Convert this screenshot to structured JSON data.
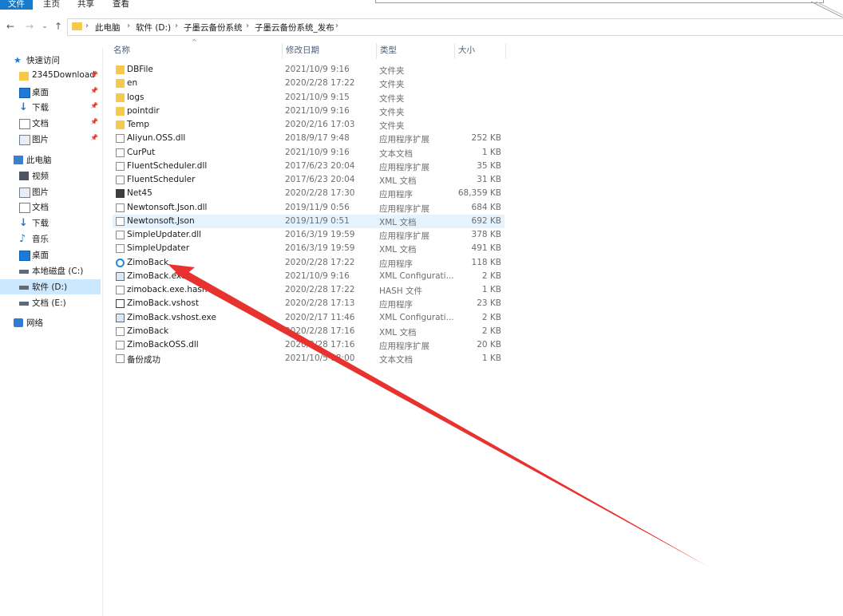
{
  "ribbon": {
    "tabs": [
      {
        "label": "文件",
        "active": true
      },
      {
        "label": "主页",
        "active": false
      },
      {
        "label": "共享",
        "active": false
      },
      {
        "label": "查看",
        "active": false
      }
    ]
  },
  "nav_buttons": {
    "back": "←",
    "forward": "→",
    "recent": "⌄",
    "up": "↑"
  },
  "breadcrumb": [
    "此电脑",
    "软件 (D:)",
    "子墨云备份系统",
    "子墨云备份系统_发布"
  ],
  "breadcrumb_sep": "›",
  "sidebar": {
    "items": [
      {
        "label": "快速访问",
        "icon": "star-icon",
        "indent": 0,
        "pinned": false,
        "selected": false
      },
      {
        "label": "2345Download",
        "icon": "folder-icon",
        "indent": 1,
        "pinned": true,
        "selected": false
      },
      {
        "label": "桌面",
        "icon": "desktop-icon",
        "indent": 1,
        "pinned": true,
        "selected": false
      },
      {
        "label": "下载",
        "icon": "download-icon",
        "indent": 1,
        "pinned": true,
        "selected": false
      },
      {
        "label": "文档",
        "icon": "document-icon",
        "indent": 1,
        "pinned": true,
        "selected": false
      },
      {
        "label": "图片",
        "icon": "pictures-icon",
        "indent": 1,
        "pinned": true,
        "selected": false
      },
      {
        "label": "此电脑",
        "icon": "computer-icon",
        "indent": 0,
        "pinned": false,
        "selected": false
      },
      {
        "label": "视频",
        "icon": "video-icon",
        "indent": 1,
        "pinned": false,
        "selected": false
      },
      {
        "label": "图片",
        "icon": "pictures-icon",
        "indent": 1,
        "pinned": false,
        "selected": false
      },
      {
        "label": "文档",
        "icon": "document-icon",
        "indent": 1,
        "pinned": false,
        "selected": false
      },
      {
        "label": "下载",
        "icon": "download-icon",
        "indent": 1,
        "pinned": false,
        "selected": false
      },
      {
        "label": "音乐",
        "icon": "music-icon",
        "indent": 1,
        "pinned": false,
        "selected": false
      },
      {
        "label": "桌面",
        "icon": "desktop-icon",
        "indent": 1,
        "pinned": false,
        "selected": false
      },
      {
        "label": "本地磁盘 (C:)",
        "icon": "drive-icon",
        "indent": 1,
        "pinned": false,
        "selected": false
      },
      {
        "label": "软件 (D:)",
        "icon": "drive-icon",
        "indent": 1,
        "pinned": false,
        "selected": true
      },
      {
        "label": "文档 (E:)",
        "icon": "drive-icon",
        "indent": 1,
        "pinned": false,
        "selected": false
      },
      {
        "label": "网络",
        "icon": "network-icon",
        "indent": 0,
        "pinned": false,
        "selected": false
      }
    ]
  },
  "pin_glyph": "📌",
  "columns": {
    "name": "名称",
    "date": "修改日期",
    "type": "类型",
    "size": "大小"
  },
  "sort_caret": "^",
  "files": [
    {
      "name": "DBFile",
      "date": "2021/10/9 9:16",
      "type": "文件夹",
      "size": "",
      "icon": "folder-icon",
      "hover": false
    },
    {
      "name": "en",
      "date": "2020/2/28 17:22",
      "type": "文件夹",
      "size": "",
      "icon": "folder-icon",
      "hover": false
    },
    {
      "name": "logs",
      "date": "2021/10/9 9:15",
      "type": "文件夹",
      "size": "",
      "icon": "folder-icon",
      "hover": false
    },
    {
      "name": "pointdir",
      "date": "2021/10/9 9:16",
      "type": "文件夹",
      "size": "",
      "icon": "folder-icon",
      "hover": false
    },
    {
      "name": "Temp",
      "date": "2020/2/16 17:03",
      "type": "文件夹",
      "size": "",
      "icon": "folder-icon",
      "hover": false
    },
    {
      "name": "Aliyun.OSS.dll",
      "date": "2018/9/17 9:48",
      "type": "应用程序扩展",
      "size": "252 KB",
      "icon": "dll-icon",
      "hover": false
    },
    {
      "name": "CurPut",
      "date": "2021/10/9 9:16",
      "type": "文本文档",
      "size": "1 KB",
      "icon": "text-file-icon",
      "hover": false
    },
    {
      "name": "FluentScheduler.dll",
      "date": "2017/6/23 20:04",
      "type": "应用程序扩展",
      "size": "35 KB",
      "icon": "dll-icon",
      "hover": false
    },
    {
      "name": "FluentScheduler",
      "date": "2017/6/23 20:04",
      "type": "XML 文档",
      "size": "31 KB",
      "icon": "xml-file-icon",
      "hover": false
    },
    {
      "name": "Net45",
      "date": "2020/2/28 17:30",
      "type": "应用程序",
      "size": "68,359 KB",
      "icon": "installer-icon",
      "hover": false
    },
    {
      "name": "Newtonsoft.Json.dll",
      "date": "2019/11/9 0:56",
      "type": "应用程序扩展",
      "size": "684 KB",
      "icon": "dll-icon",
      "hover": false
    },
    {
      "name": "Newtonsoft.Json",
      "date": "2019/11/9 0:51",
      "type": "XML 文档",
      "size": "692 KB",
      "icon": "xml-file-icon",
      "hover": true
    },
    {
      "name": "SimpleUpdater.dll",
      "date": "2016/3/19 19:59",
      "type": "应用程序扩展",
      "size": "378 KB",
      "icon": "dll-icon",
      "hover": false
    },
    {
      "name": "SimpleUpdater",
      "date": "2016/3/19 19:59",
      "type": "XML 文档",
      "size": "491 KB",
      "icon": "xml-file-icon",
      "hover": false
    },
    {
      "name": "ZimoBack",
      "date": "2020/2/28 17:22",
      "type": "应用程序",
      "size": "118 KB",
      "icon": "zimoback-app-icon",
      "hover": false
    },
    {
      "name": "ZimoBack.exe",
      "date": "2021/10/9 9:16",
      "type": "XML Configurati...",
      "size": "2 KB",
      "icon": "config-file-icon",
      "hover": false
    },
    {
      "name": "zimoback.exe.hash",
      "date": "2020/2/28 17:22",
      "type": "HASH 文件",
      "size": "1 KB",
      "icon": "file-icon",
      "hover": false
    },
    {
      "name": "ZimoBack.vshost",
      "date": "2020/2/28 17:13",
      "type": "应用程序",
      "size": "23 KB",
      "icon": "app-icon",
      "hover": false
    },
    {
      "name": "ZimoBack.vshost.exe",
      "date": "2020/2/17 11:46",
      "type": "XML Configurati...",
      "size": "2 KB",
      "icon": "config-file-icon",
      "hover": false
    },
    {
      "name": "ZimoBack",
      "date": "2020/2/28 17:16",
      "type": "XML 文档",
      "size": "2 KB",
      "icon": "xml-file-icon",
      "hover": false
    },
    {
      "name": "ZimoBackOSS.dll",
      "date": "2020/2/28 17:16",
      "type": "应用程序扩展",
      "size": "20 KB",
      "icon": "dll-icon",
      "hover": false
    },
    {
      "name": "备份成功",
      "date": "2021/10/5 18:00",
      "type": "文本文档",
      "size": "1 KB",
      "icon": "text-file-icon",
      "hover": false
    }
  ],
  "annotation": {
    "color": "#e8322f",
    "points_to": "ZimoBack"
  }
}
